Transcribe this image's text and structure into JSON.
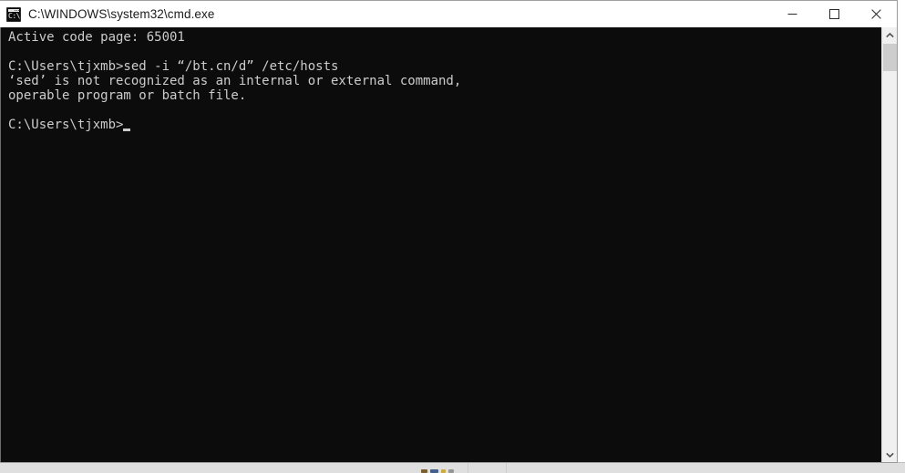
{
  "window": {
    "title": "C:\\WINDOWS\\system32\\cmd.exe",
    "icon": "cmd-console-icon",
    "icon_glyph": "C:\\",
    "background_color": "#0c0c0c",
    "foreground_color": "#cccccc",
    "titlebar_color": "#ffffff"
  },
  "window_controls": {
    "minimize_label": "Minimize",
    "maximize_label": "Maximize",
    "close_label": "Close"
  },
  "console": {
    "lines": [
      "Active code page: 65001",
      "",
      "C:\\Users\\tjxmb>sed -i “/bt.cn/d” /etc/hosts",
      "‘sed’ is not recognized as an internal or external command,",
      "operable program or batch file.",
      "",
      "C:\\Users\\tjxmb>"
    ],
    "text": "Active code page: 65001\n\nC:\\Users\\tjxmb>sed -i “/bt.cn/d” /etc/hosts\n‘sed’ is not recognized as an internal or external command,\noperable program or batch file.\n\nC:\\Users\\tjxmb>",
    "prompt": "C:\\Users\\tjxmb>",
    "last_command": "sed -i “/bt.cn/d” /etc/hosts",
    "code_page": "65001",
    "cursor": "block"
  },
  "scrollbar": {
    "up_arrow": "chevron-up-icon",
    "down_arrow": "chevron-down-icon",
    "thumb_label": "scrollbar-thumb"
  }
}
